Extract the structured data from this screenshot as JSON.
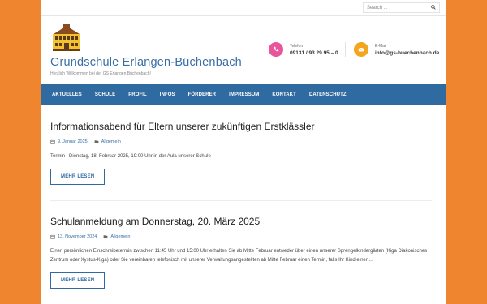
{
  "search": {
    "placeholder": "Search ..."
  },
  "site": {
    "title": "Grundschule Erlangen-Büchenbach",
    "tagline": "Herzlich Willkommen bei der GS Erlangen Büchenbach!"
  },
  "contact": {
    "phone_label": "Telefon",
    "phone_value": "09131 / 93 29 95 – 0",
    "email_label": "E-Mail",
    "email_value": "info@gs-buechenbach.de"
  },
  "nav": [
    "AKTUELLES",
    "SCHULE",
    "PROFIL",
    "INFOS",
    "FÖRDERER",
    "IMPRESSUM",
    "KONTAKT",
    "DATENSCHUTZ"
  ],
  "posts": [
    {
      "title": "Informationsabend für Eltern unserer zukünftigen Erstklässler",
      "date": "9. Januar 2025",
      "category": "Allgemein",
      "excerpt": "Termin : Dienstag, 18. Februar 2025, 19:00 Uhr in der Aula unserer Schule",
      "button": "MEHR LESEN"
    },
    {
      "title": "Schulanmeldung am Donnerstag, 20. März 2025",
      "date": "13. November 2024",
      "category": "Allgemein",
      "excerpt": "Einen persönlichen Einschreibetermin zwischen 11:45 Uhr und 15:00 Uhr erhalten Sie ab Mitte Februar entweder über einen unserer Sprengelkindergärten (Kiga Diakonisches Zentrum oder Xystus-Kiga) oder Sie vereinbaren telefonisch mit unserer Verwaltungsangestellten ab Mitte Februar einen Termin, falls Ihr Kind einen…",
      "button": "MEHR LESEN"
    }
  ],
  "colors": {
    "background": "#f0852f",
    "nav": "#2f6aa0",
    "phone_icon": "#e8559b",
    "email_icon": "#f2a51d"
  }
}
